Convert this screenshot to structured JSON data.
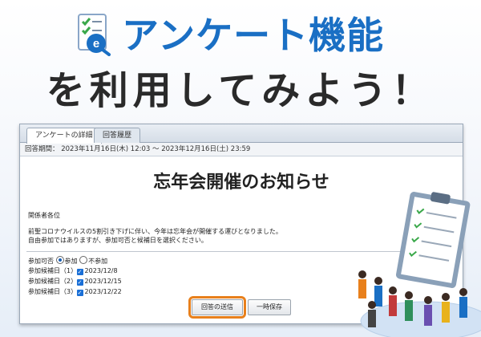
{
  "hero": {
    "title": "アンケート機能",
    "subtitle": "を利用してみよう！"
  },
  "tabs": [
    {
      "label": "アンケートの詳細",
      "active": true
    },
    {
      "label": "回答履歴",
      "active": false
    }
  ],
  "period": "回答期間： 2023年11月16日(木) 12:03 〜 2023年12月16日(土) 23:59",
  "survey": {
    "title": "忘年会開催のお知らせ",
    "salutation": "関係者各位",
    "body_line1": "前聖コロナウイルスの5割引き下げに伴い、今年は忘年会が開催する運びとなりました。",
    "body_line2": "自由参加ではありますが、参加可否と候補日を選択ください。"
  },
  "form": {
    "attend_label": "参加可否",
    "attend_yes": "参加",
    "attend_no": "不参加",
    "attend_selected": "参加",
    "candidates": [
      {
        "label": "参加候補日（1）",
        "date": "2023/12/8",
        "checked": true
      },
      {
        "label": "参加候補日（2）",
        "date": "2023/12/15",
        "checked": true
      },
      {
        "label": "参加候補日（3）",
        "date": "2023/12/22",
        "checked": true
      }
    ]
  },
  "buttons": {
    "submit": "回答の送信",
    "save": "一時保存"
  },
  "colors": {
    "title_blue": "#1a6fc4",
    "highlight_orange": "#e8801c",
    "checkbox_blue": "#1a6fd6"
  }
}
